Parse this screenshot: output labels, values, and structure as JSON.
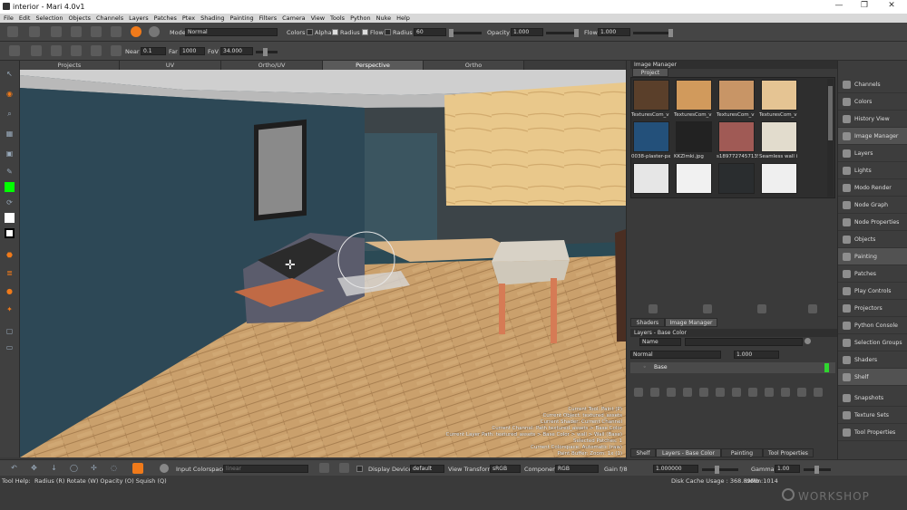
{
  "window": {
    "title": "interior - Mari 4.0v1",
    "minimize": "—",
    "maximize": "❐",
    "close": "✕"
  },
  "menu": [
    "File",
    "Edit",
    "Selection",
    "Objects",
    "Channels",
    "Layers",
    "Patches",
    "Ptex",
    "Shading",
    "Painting",
    "Filters",
    "Camera",
    "View",
    "Tools",
    "Python",
    "Nuke",
    "Help"
  ],
  "toolbar1": {
    "mode_label": "Mode",
    "mode_value": "Normal",
    "colors_label": "Colors",
    "alpha_label": "Alpha",
    "radius_label": "Radius",
    "flow_label": "Flow",
    "radius2_label": "Radius",
    "radius_value": "60",
    "opacity_label": "Opacity",
    "opacity_value": "1.000",
    "flow2_label": "Flow",
    "flow_value": "1.000"
  },
  "toolbar2": {
    "near_label": "Near",
    "near_value": "0.1",
    "far_label": "Far",
    "far_value": "1000",
    "fov_label": "FoV",
    "fov_value": "34.000"
  },
  "view_tabs": [
    "Projects",
    "UV",
    "Ortho/UV",
    "Perspective",
    "Ortho"
  ],
  "active_view_tab": "Perspective",
  "viewport_info": [
    "Current Tool: Paint (P)",
    "Current Object: textured_assets",
    "Current Shader: Current Channel",
    "Current Channel: Path textured_assets > Base Color",
    "Current Layer Path: textured_assets > Base Color > wall > Wall (Base)",
    "Selected Patches: 1",
    "Current Colorspace: Automatic (raw)",
    "Paint Buffer: Zoom: 1x (1)"
  ],
  "image_manager": {
    "title": "Image Manager",
    "tab": "Project",
    "thumb_labels": [
      "TexturesCom_v",
      "TexturesCom_v",
      "TexturesCom_v",
      "TexturesCom_v",
      "0038-plaster-px",
      "KKZlmki.jpg",
      "s1897727457135",
      "Seamless wall i"
    ],
    "thumb_colors": [
      "#5a3f2a",
      "#d19a5c",
      "#c89566",
      "#e5c493",
      "#23507a",
      "#222222",
      "#a05a55",
      "#e2dccd",
      "#e6e6e6",
      "#f1f1f1",
      "#2a2d2f",
      "#efefef"
    ],
    "bottom_tabs": [
      "Shaders",
      "Image Manager"
    ]
  },
  "layers": {
    "title": "Layers - Base Color",
    "filter_label": "Name",
    "blend_mode": "Normal",
    "opacity": "1.000",
    "layer_name": "Base",
    "bottom_tabs": [
      "Shelf",
      "Layers - Base Color",
      "Painting",
      "Tool Properties"
    ]
  },
  "palettes": [
    "Channels",
    "Colors",
    "History View",
    "Image Manager",
    "Layers",
    "Lights",
    "Modo Render",
    "Node Graph",
    "Node Properties",
    "Objects",
    "Painting",
    "Patches",
    "Play Controls",
    "Projectors",
    "Python Console",
    "Selection Groups",
    "Shaders",
    "Shelf",
    "Snapshots",
    "Texture Sets",
    "Tool Properties"
  ],
  "active_palettes": [
    "Image Manager",
    "Painting",
    "Shelf"
  ],
  "bottom_toolbar": {
    "input_colorspace_label": "Input Colorspace",
    "input_colorspace_value": "linear",
    "display_device_label": "Display Device",
    "display_device_value": "default",
    "view_transform_label": "View Transform",
    "view_transform_value": "sRGB",
    "component_label": "Component",
    "component_value": "RGB",
    "gain_label": "Gain f/8",
    "gain_value": "1.000000",
    "gamma_label": "Gamma",
    "gamma_value": "1.00"
  },
  "status": {
    "tool_help": "Tool Help:",
    "hints": "Radius (R)   Rotate (W)   Opacity (O)   Squish (Q)",
    "disk_cache": "Disk Cache Usage : 368.89Mb",
    "udim": "Udim:1014"
  },
  "watermark": "WORKSHOP",
  "colors": {
    "accent": "#f07a1a",
    "swatch_fg": "#00ff00",
    "swatch_bg": "#ffffff",
    "viewport_wall": "#2f4650"
  }
}
